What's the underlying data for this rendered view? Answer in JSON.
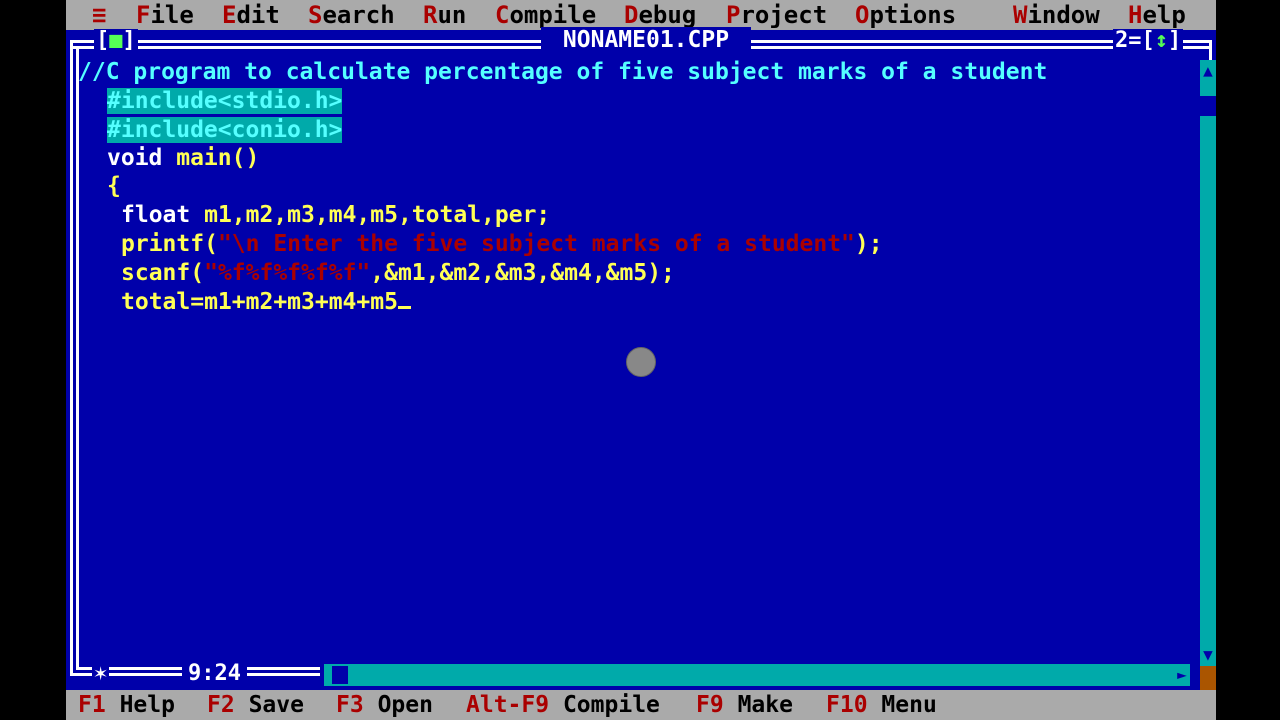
{
  "menubar": {
    "system": "≡",
    "items": [
      {
        "hot": "F",
        "rest": "ile"
      },
      {
        "hot": "E",
        "rest": "dit"
      },
      {
        "hot": "S",
        "rest": "earch"
      },
      {
        "hot": "R",
        "rest": "un"
      },
      {
        "hot": "C",
        "rest": "ompile"
      },
      {
        "hot": "D",
        "rest": "ebug"
      },
      {
        "hot": "P",
        "rest": "roject"
      },
      {
        "hot": "O",
        "rest": "ptions"
      },
      {
        "hot": "W",
        "rest": "indow"
      },
      {
        "hot": "H",
        "rest": "elp"
      }
    ]
  },
  "window": {
    "title": "NONAME01.CPP",
    "close_box": "■",
    "number": "2",
    "zoom_box": "↕",
    "cursor_position": "9:24",
    "modified_mark": "✶"
  },
  "code": {
    "line1": "//C program to calculate percentage of five subject marks of a student",
    "line2": "#include<stdio.h>",
    "line3": "#include<conio.h>",
    "line4_kw": "void",
    "line4_rest": " main()",
    "line5": "{",
    "line6_kw": "float",
    "line6_rest": " m1,m2,m3,m4,m5,total,per;",
    "line7_fn": "printf(",
    "line7_str": "\"\\n Enter the five subject marks of a student\"",
    "line7_end": ");",
    "line8_fn": "scanf(",
    "line8_str": "\"%f%f%f%f%f\"",
    "line8_end": ",&m1,&m2,&m3,&m4,&m5);",
    "line9": "total=m1+m2+m3+m4+m5"
  },
  "statusbar": [
    {
      "key": "F1",
      "label": "Help"
    },
    {
      "key": "F2",
      "label": "Save"
    },
    {
      "key": "F3",
      "label": "Open"
    },
    {
      "key": "Alt-F9",
      "label": "Compile"
    },
    {
      "key": "F9",
      "label": "Make"
    },
    {
      "key": "F10",
      "label": "Menu"
    }
  ],
  "colors": {
    "background": "#0000aa",
    "menu": "#aaaaaa",
    "hotkey": "#aa0000",
    "string": "#aa0000",
    "comment": "#55ffff",
    "identifier": "#ffff55"
  }
}
